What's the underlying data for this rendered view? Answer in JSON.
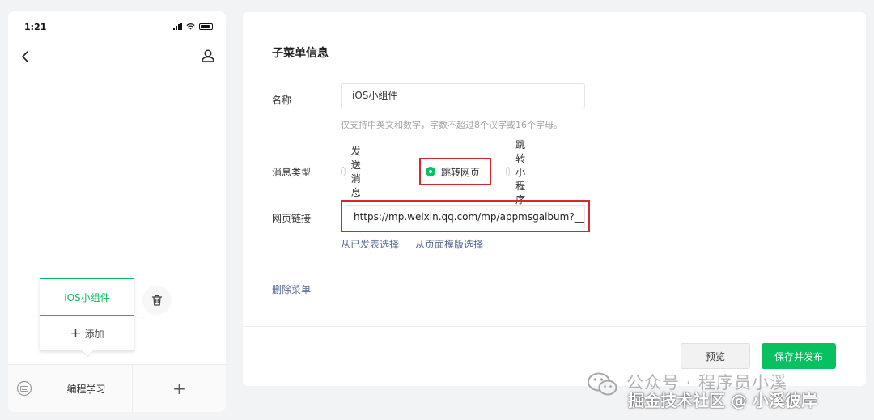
{
  "phone": {
    "time": "1:21",
    "popup_item": "iOS小组件",
    "popup_add": "添加",
    "bottom_menu": "编程学习",
    "bottom_add": "+"
  },
  "panel": {
    "title": "子菜单信息",
    "name_label": "名称",
    "name_value": "iOS小组件",
    "name_hint": "仅支持中英文和数字，字数不超过8个汉字或16个字母。",
    "msg_type_label": "消息类型",
    "msg_type_options": [
      "发送消息",
      "跳转网页",
      "跳转小程序"
    ],
    "msg_type_selected": "跳转网页",
    "url_label": "网页链接",
    "url_value": "https://mp.weixin.qq.com/mp/appmsgalbum?__l",
    "link_published": "从已发表选择",
    "link_template": "从页面模版选择",
    "delete_menu": "删除菜单",
    "btn_preview": "预览",
    "btn_save": "保存并发布"
  },
  "watermark": {
    "line1": "公众号 · 程序员小溪",
    "line2": "掘金技术社区 @ 小溪彼岸"
  },
  "colors": {
    "accent": "#07c160",
    "highlight": "#d8262e",
    "link": "#576b95"
  }
}
